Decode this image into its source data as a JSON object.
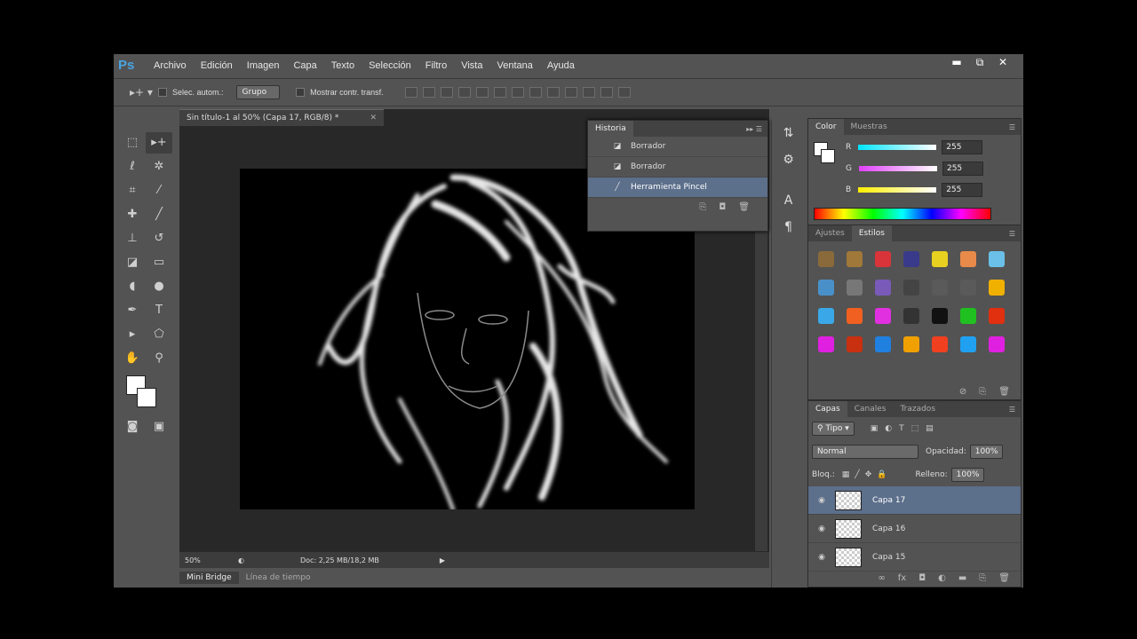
{
  "app": {
    "logo": "Ps",
    "menu": [
      "Archivo",
      "Edición",
      "Imagen",
      "Capa",
      "Texto",
      "Selección",
      "Filtro",
      "Vista",
      "Ventana",
      "Ayuda"
    ],
    "window_controls": [
      "▬",
      "⧉",
      "✕"
    ]
  },
  "options": {
    "auto_select_label": "Selec. autom.:",
    "auto_select_value": "Grupo",
    "show_transform_label": "Mostrar contr. transf."
  },
  "document": {
    "tab_title": "Sin título-1 al 50% (Capa 17, RGB/8) *",
    "zoom": "50%",
    "doc_info": "Doc: 2,25 MB/18,2 MB"
  },
  "bottom_tabs": [
    "Mini Bridge",
    "Línea de tiempo"
  ],
  "history": {
    "tabs": [
      "Historia"
    ],
    "items": [
      {
        "label": "Borrador",
        "icon": "eraser-icon"
      },
      {
        "label": "Borrador",
        "icon": "eraser-icon"
      },
      {
        "label": "Herramienta Pincel",
        "icon": "brush-icon"
      }
    ]
  },
  "color_panel": {
    "tabs": [
      "Color",
      "Muestras"
    ],
    "r_label": "R",
    "g_label": "G",
    "b_label": "B",
    "r": "255",
    "g": "255",
    "b": "255",
    "colors": {
      "r_bar": "#00e5ff",
      "g_bar": "#e040fb",
      "b_bar": "#ffee00"
    }
  },
  "styles_panel": {
    "tabs": [
      "Ajustes",
      "Estilos"
    ]
  },
  "layers_panel": {
    "tabs": [
      "Capas",
      "Canales",
      "Trazados"
    ],
    "filter": "Tipo",
    "blend_mode": "Normal",
    "opacity_label": "Opacidad:",
    "opacity": "100%",
    "lock_label": "Bloq.:",
    "fill_label": "Relleno:",
    "fill": "100%",
    "layers": [
      {
        "name": "Capa 17",
        "selected": true
      },
      {
        "name": "Capa 16",
        "selected": false
      },
      {
        "name": "Capa 15",
        "selected": false
      }
    ]
  }
}
